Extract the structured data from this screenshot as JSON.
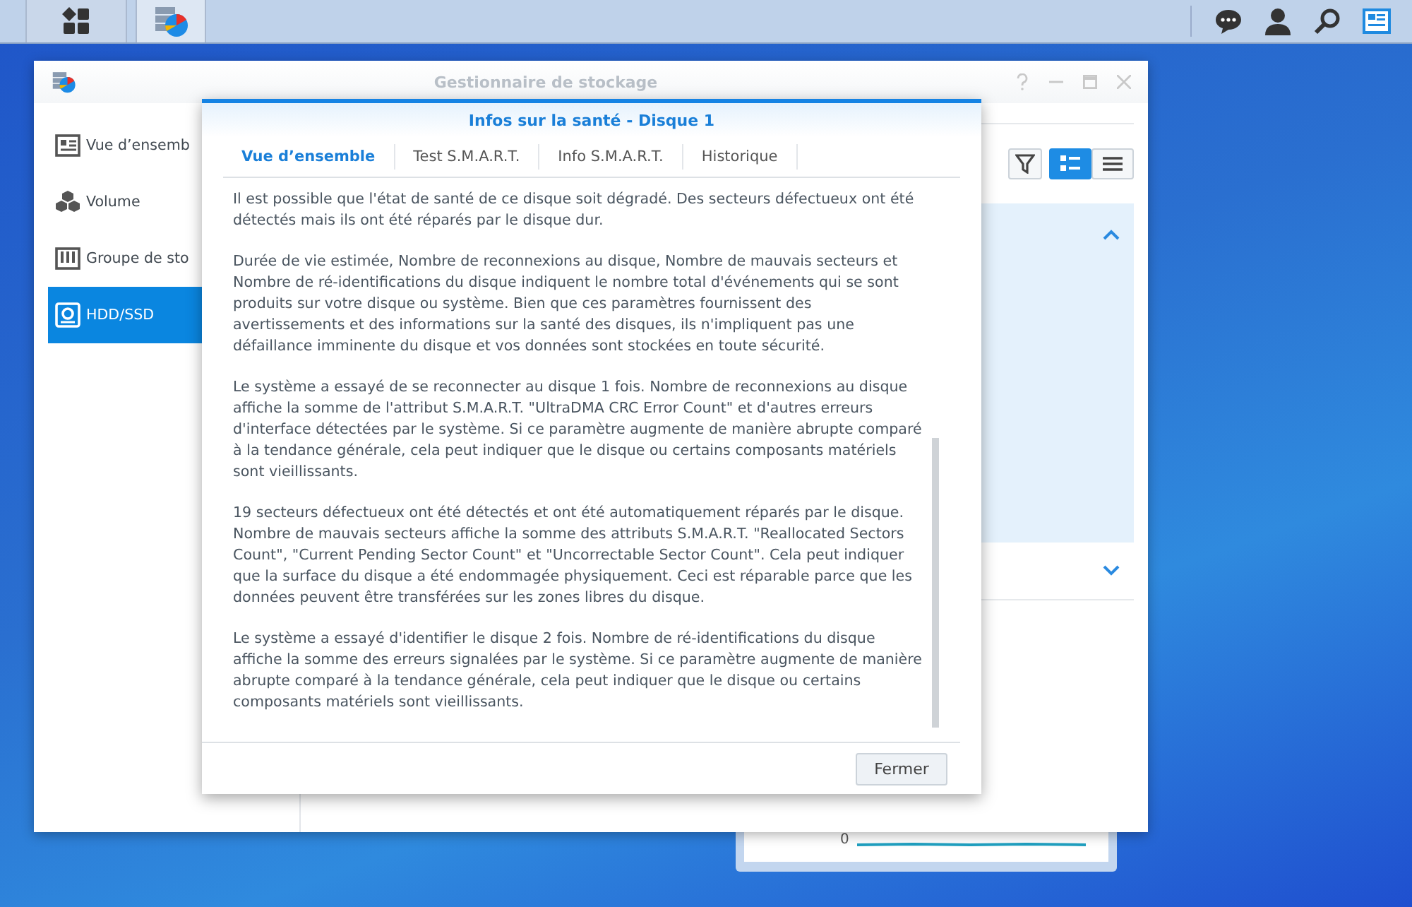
{
  "window": {
    "title": "Gestionnaire de stockage"
  },
  "sidebar": {
    "items": [
      {
        "label": "Vue d’ensemb",
        "kind": "overview",
        "selected": false
      },
      {
        "label": "Volume",
        "kind": "volume",
        "selected": false
      },
      {
        "label": "Groupe de sto",
        "kind": "pool",
        "selected": false
      },
      {
        "label": "HDD/SSD",
        "kind": "disk",
        "selected": true
      }
    ]
  },
  "view_buttons": [
    {
      "kind": "list",
      "selected": true
    },
    {
      "kind": "lines",
      "selected": false
    }
  ],
  "dialog": {
    "title": "Infos sur la santé - Disque 1",
    "tabs": [
      {
        "label": "Vue d’ensemble",
        "selected": true
      },
      {
        "label": "Test S.M.A.R.T.",
        "selected": false
      },
      {
        "label": "Info S.M.A.R.T.",
        "selected": false
      },
      {
        "label": "Historique",
        "selected": false
      }
    ],
    "paragraphs": [
      "Il est possible que l'état de santé de ce disque soit dégradé. Des secteurs défectueux ont été détectés mais ils ont été réparés par le disque dur.",
      "Durée de vie estimée, Nombre de reconnexions au disque, Nombre de mauvais secteurs et Nombre de ré-identifications du disque indiquent le nombre total d'événements qui se sont produits sur votre disque ou système. Bien que ces paramètres fournissent des avertissements et des informations sur la santé des disques, ils n'impliquent pas une défaillance imminente du disque et vos données sont stockées en toute sécurité.",
      "Le système a essayé de se reconnecter au disque 1 fois. Nombre de reconnexions au disque affiche la somme de l'attribut S.M.A.R.T. \"UltraDMA CRC Error Count\" et d'autres erreurs d'interface détectées par le système. Si ce paramètre augmente de manière abrupte comparé à la tendance générale, cela peut indiquer que le disque ou certains composants matériels sont vieillissants.",
      "19 secteurs défectueux ont été détectés et ont été automatiquement réparés par le disque. Nombre de mauvais secteurs affiche la somme des attributs S.M.A.R.T. \"Reallocated Sectors Count\", \"Current Pending Sector Count\" et \"Uncorrectable Sector Count\". Cela peut indiquer que la surface du disque a été endommagée physiquement. Ceci est réparable parce que les données peuvent être transférées sur les zones libres du disque.",
      "Le système a essayé d'identifier le disque 2 fois. Nombre de ré-identifications du disque affiche la somme des erreurs signalées par le système. Si ce paramètre augmente de manière abrupte comparé à la tendance générale, cela peut indiquer que le disque ou certains composants matériels sont vieillissants."
    ],
    "button": "Fermer"
  },
  "widget": {
    "axis_label": "0"
  }
}
